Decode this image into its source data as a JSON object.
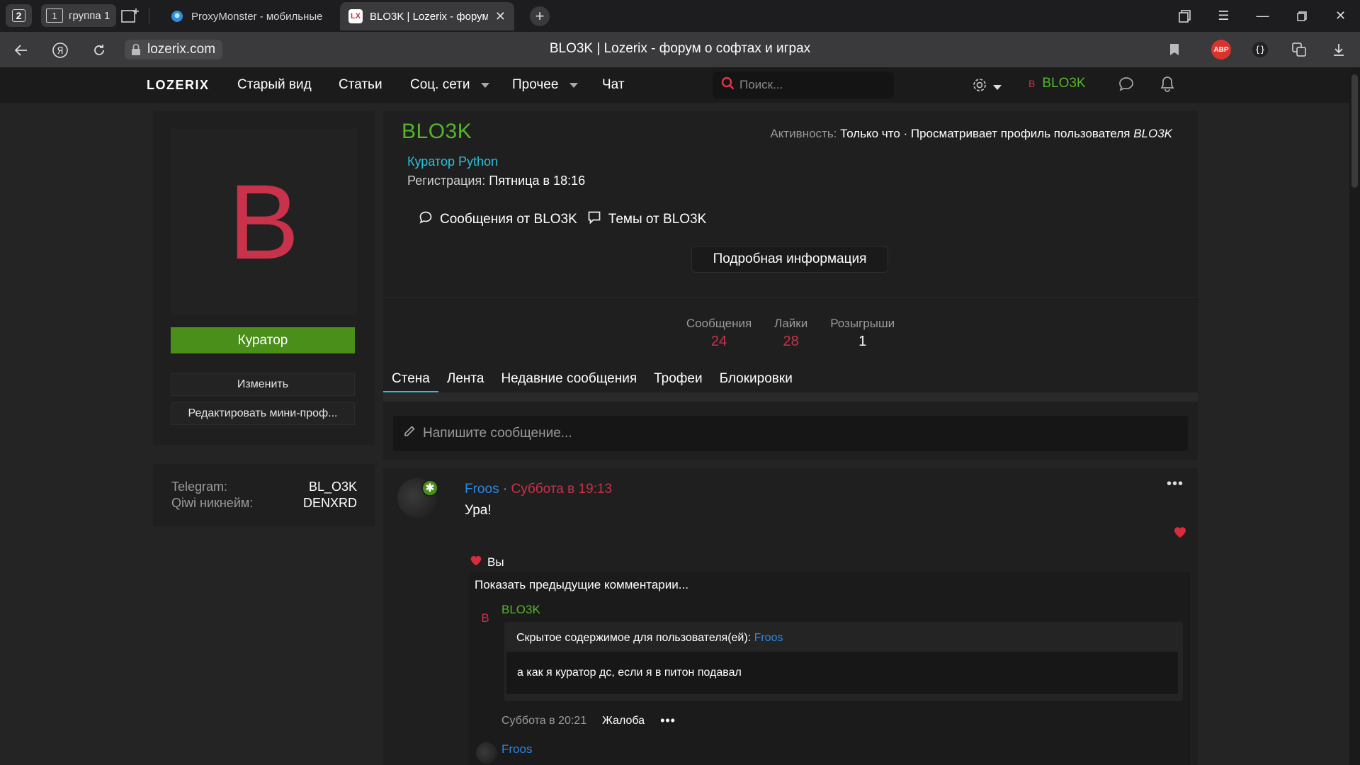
{
  "browser": {
    "tab_counter": "2",
    "group": {
      "num": "1",
      "label": "группа 1"
    },
    "tabs": [
      {
        "title": "ProxyMonster - мобильные прокси"
      },
      {
        "title": "BLO3K | Lozerix - форум о софтах и играх",
        "favicon": "LX"
      }
    ],
    "url": "lozerix.com",
    "page_title": "BLO3K | Lozerix - форум о софтах и играх",
    "abp": "ABP"
  },
  "nav": {
    "logo": "LOZERIX",
    "links": [
      "Старый вид",
      "Статьи",
      "Соц. сети",
      "Прочее",
      "Чат"
    ],
    "search_placeholder": "Поиск...",
    "user_initial": "B",
    "user_name": "BLO3K"
  },
  "sidebar": {
    "avatar_letter": "B",
    "role_button": "Куратор",
    "edit_button": "Изменить",
    "edit_mini_button": "Редактировать мини-проф...",
    "info": [
      {
        "key": "Telegram:",
        "value": "BL_O3K"
      },
      {
        "key": "Qiwi никнейм:",
        "value": "DENXRD"
      }
    ]
  },
  "profile": {
    "username": "BLO3K",
    "activity_label": "Активность:",
    "activity_value": "Только что · Просматривает профиль пользователя",
    "activity_user": "BLO3K",
    "role": "Куратор Python",
    "reg_label": "Регистрация:",
    "reg_value": "Пятница в 18:16",
    "messages_link": "Сообщения от BLO3K",
    "threads_link": "Темы от BLO3K",
    "details_button": "Подробная информация",
    "stats": [
      {
        "label": "Сообщения",
        "value": "24"
      },
      {
        "label": "Лайки",
        "value": "28"
      },
      {
        "label": "Розыгрыши",
        "value": "1"
      }
    ],
    "tabs": [
      "Стена",
      "Лента",
      "Недавние сообщения",
      "Трофеи",
      "Блокировки"
    ],
    "compose_placeholder": "Напишите сообщение..."
  },
  "post": {
    "author": "Froos",
    "separator": "·",
    "time": "Суббота в 19:13",
    "body": "Ура!",
    "reactions": "Вы",
    "show_previous": "Показать предыдущие комментарии...",
    "comment": {
      "avatar": "B",
      "author": "BLO3K",
      "hidden_label": "Скрытое содержимое для пользователя(ей):",
      "hidden_user": "Froos",
      "text": "а как я куратор дс, если я в питон подавал",
      "time": "Суббота в 20:21",
      "report": "Жалоба",
      "more": "•••"
    },
    "comment2_author": "Froos"
  }
}
